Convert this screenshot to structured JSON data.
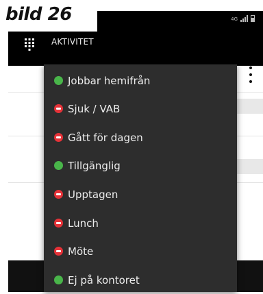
{
  "caption": "bild 26",
  "status_bar": {
    "network_label": "4G"
  },
  "app_bar": {
    "title": "AKTIVITET",
    "menu_icon": "dialpad-icon"
  },
  "colors": {
    "available": "#49b54a",
    "busy": "#e53238",
    "menu_bg": "#2d2d2d",
    "app_bar_bg": "#000000"
  },
  "menu": {
    "items": [
      {
        "label": "Jobbar hemifrån",
        "status": "green"
      },
      {
        "label": "Sjuk / VAB",
        "status": "red"
      },
      {
        "label": "Gått för dagen",
        "status": "red"
      },
      {
        "label": "Tillgänglig",
        "status": "green"
      },
      {
        "label": "Upptagen",
        "status": "red"
      },
      {
        "label": "Lunch",
        "status": "red"
      },
      {
        "label": "Möte",
        "status": "red"
      },
      {
        "label": "Ej på kontoret",
        "status": "green"
      }
    ]
  }
}
